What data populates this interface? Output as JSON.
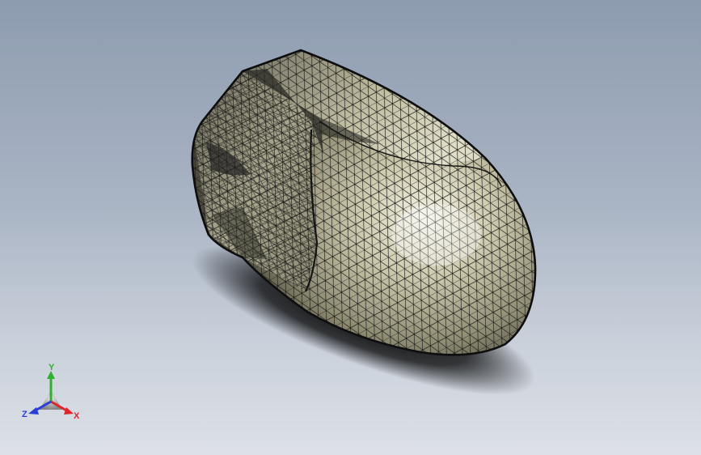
{
  "viewport": {
    "background_top": "#8e9cb0",
    "background_bottom": "#dde1e7",
    "model": {
      "name": "mouse-shell-mesh",
      "display_mode": "shaded-with-mesh-edges",
      "surface_color": "#c9c6a6",
      "edge_color": "#1a1a1a",
      "shadow_color": "#000000"
    }
  },
  "triad": {
    "x_label": "X",
    "y_label": "Y",
    "z_label": "Z",
    "x_color": "#e0242a",
    "y_color": "#2fb12f",
    "z_color": "#2a3fd8"
  }
}
